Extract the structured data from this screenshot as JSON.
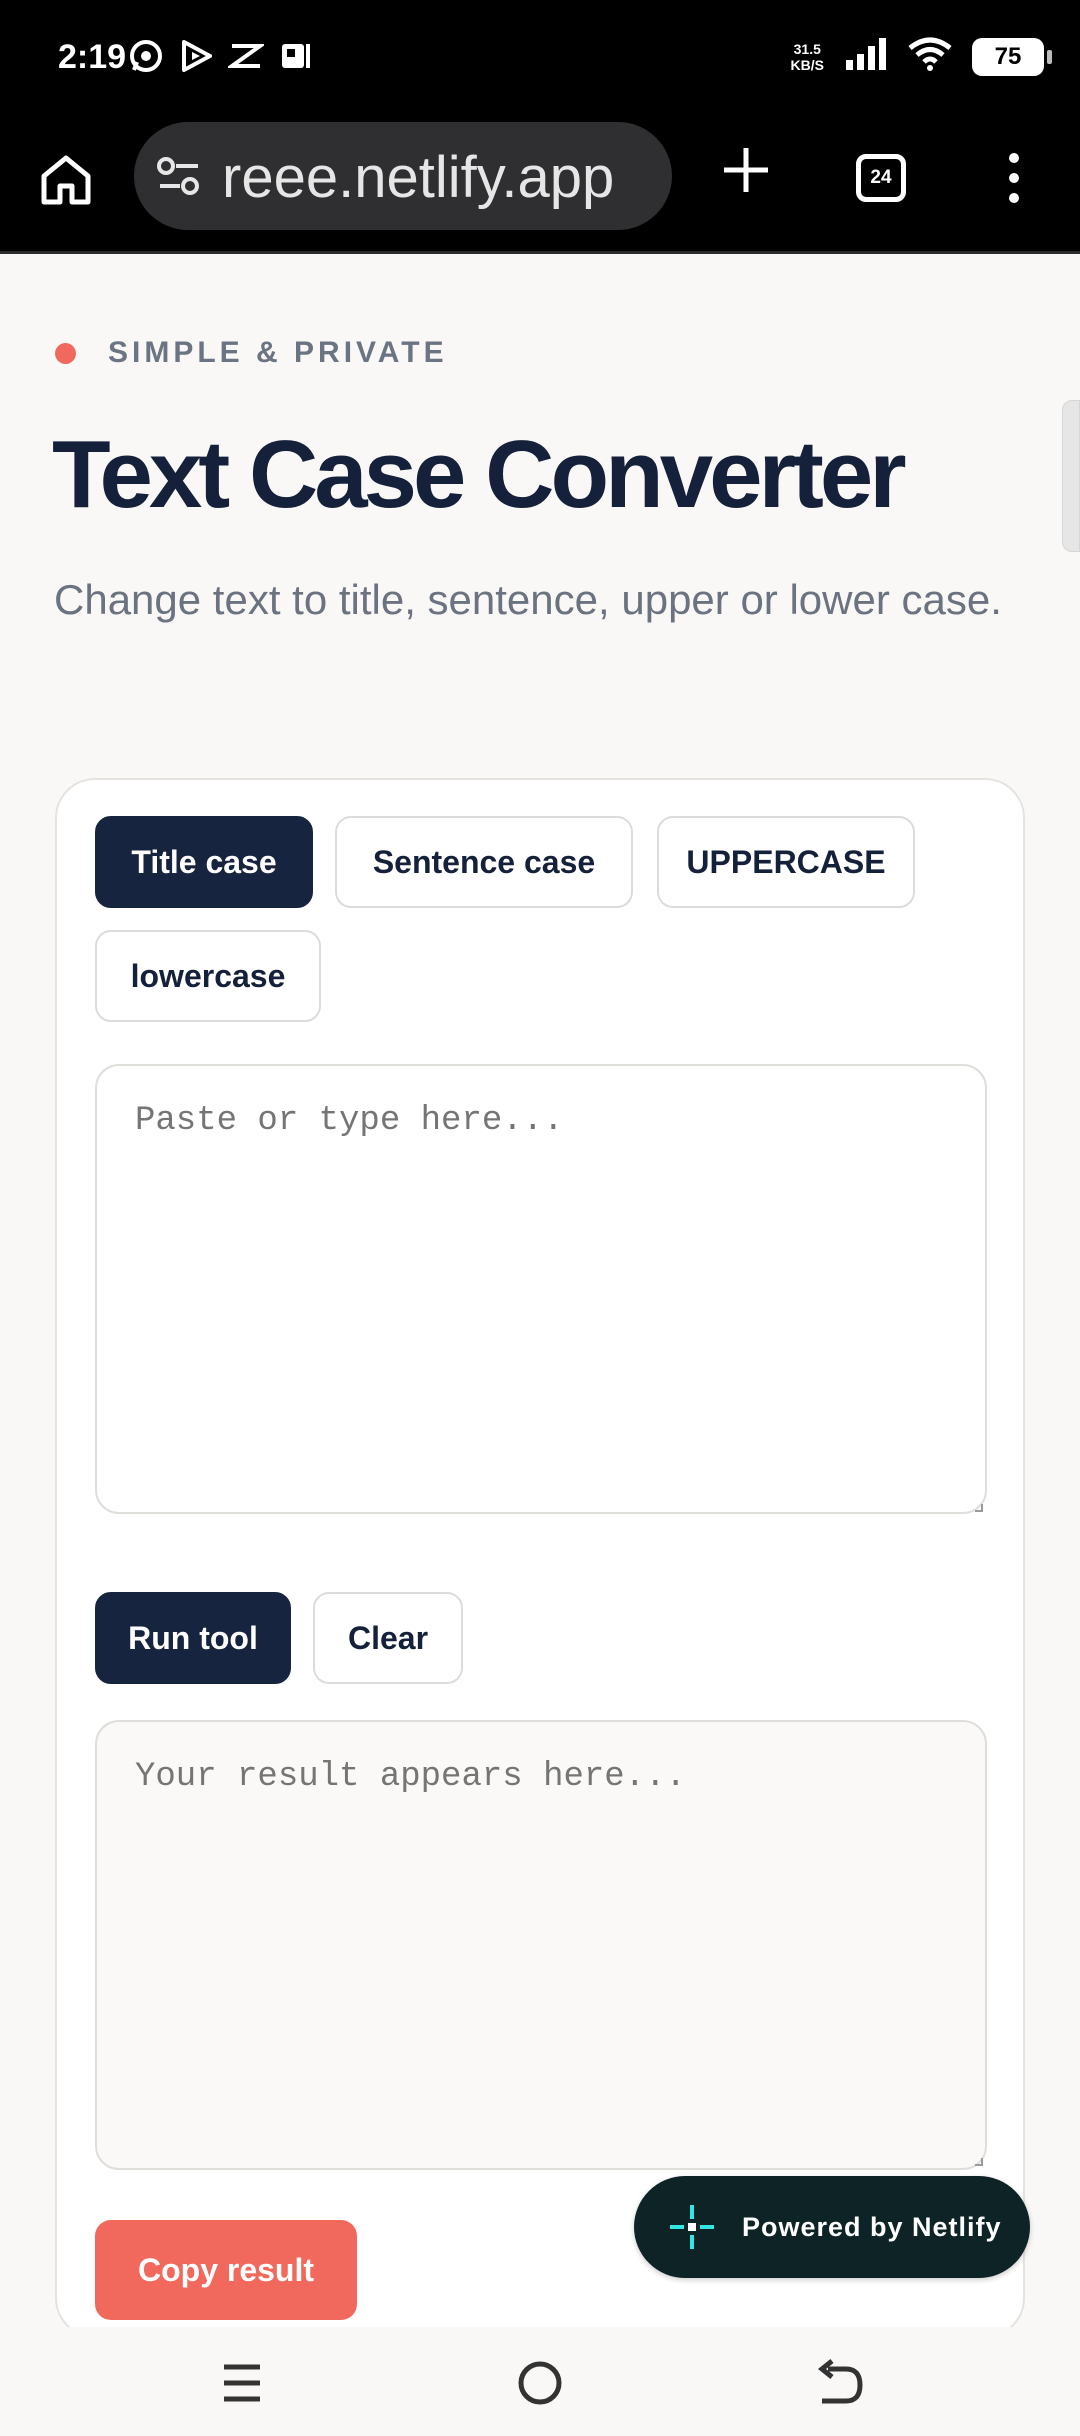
{
  "status_bar": {
    "time": "2:19",
    "net_speed_value": "31.5",
    "net_speed_unit": "KB/S",
    "battery": "75",
    "icons": [
      "whatsapp-icon",
      "media-icon",
      "capcut-icon",
      "paytm-icon",
      "signal-icon",
      "wifi-icon"
    ]
  },
  "browser": {
    "url": "reee.netlify.app",
    "tab_count": "24"
  },
  "page": {
    "eyebrow": "SIMPLE & PRIVATE",
    "title": "Text Case Converter",
    "subtitle": "Change text to title, sentence, upper or lower case.",
    "modes": [
      "Title case",
      "Sentence case",
      "UPPERCASE",
      "lowercase"
    ],
    "active_mode": "Title case",
    "input": {
      "value": "",
      "placeholder": "Paste or type here..."
    },
    "run_label": "Run tool",
    "clear_label": "Clear",
    "output": {
      "value": "",
      "placeholder": "Your result appears here..."
    },
    "copy_label": "Copy result"
  },
  "badge": {
    "text": "Powered by Netlify"
  },
  "colors": {
    "primary": "#172440",
    "accent": "#f1695c",
    "badge_bg": "#0d2326",
    "netlify_teal": "#32e6e2"
  }
}
